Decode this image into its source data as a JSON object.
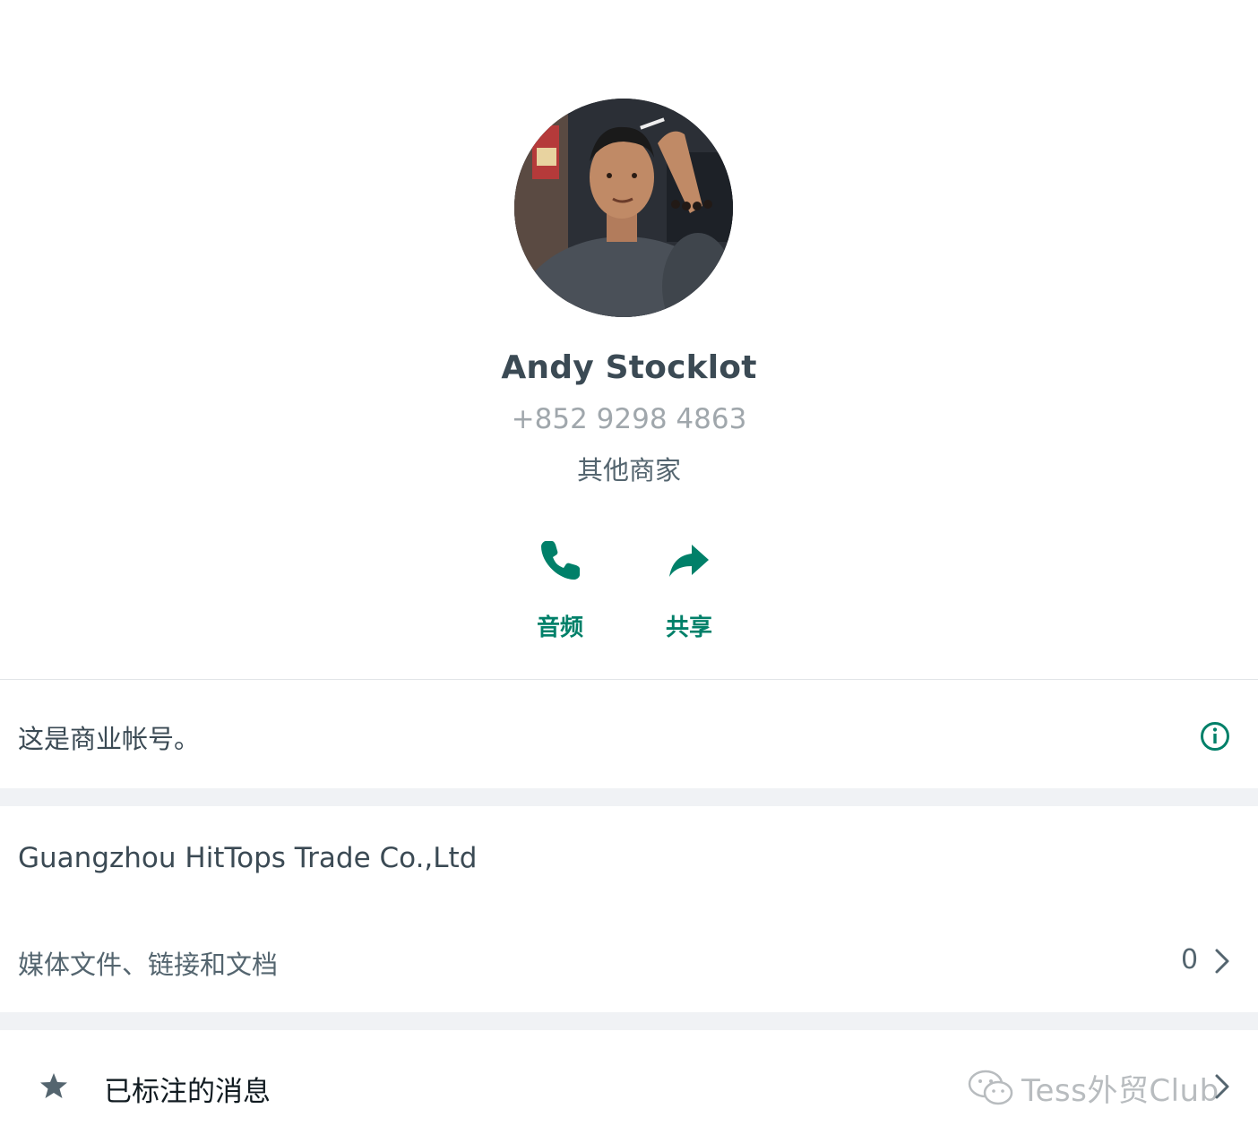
{
  "contact": {
    "name": "Andy Stocklot",
    "phone": "+852 9298 4863",
    "category": "其他商家"
  },
  "actions": {
    "audio_label": "音频",
    "share_label": "共享"
  },
  "business_notice": "这是商业帐号。",
  "company": {
    "name": "Guangzhou HitTops Trade Co.,Ltd"
  },
  "media": {
    "label": "媒体文件、链接和文档",
    "count": "0"
  },
  "starred": {
    "label": "已标注的消息"
  },
  "watermark": {
    "text": "Tess外贸Club"
  },
  "colors": {
    "accent": "#008069",
    "section_gap": "#f0f2f5",
    "primary_text": "#3b4a54",
    "secondary_text": "#a0a7ac"
  },
  "icons": {
    "audio": "phone-icon",
    "share": "share-arrow-icon",
    "info": "info-icon",
    "media": "chevron-right-icon",
    "starred": "star-icon"
  }
}
